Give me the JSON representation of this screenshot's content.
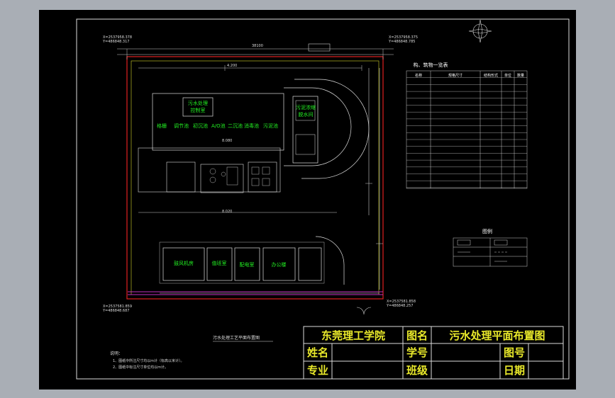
{
  "title_block": {
    "school": "东莞理工学院",
    "drawing_name_label": "图名",
    "drawing_name": "污水处理平面布置图",
    "name_label": "姓名",
    "student_id_label": "学号",
    "drawing_no_label": "图号",
    "major_label": "专业",
    "class_label": "班级",
    "date_label": "日期"
  },
  "plan": {
    "caption": "污水处理工艺平面布置图",
    "notes_title": "说明：",
    "note_1": "1、图纸中所注尺寸均以m计（标高以米计）。",
    "note_2": "2、图纸中标注尺寸单位均以m计。"
  },
  "buildings": {
    "top_green_1": "污水处理",
    "top_green_2": "控制室",
    "tanks_row": [
      "格栅",
      "调节池",
      "初沉池",
      "A/O池",
      "二沉池",
      "消毒池",
      "污泥池"
    ],
    "right_green_1": "污泥浓缩",
    "right_green_2": "脱水间",
    "bottom_rooms": [
      "鼓风机房",
      "值班室",
      "配电室",
      "办公楼"
    ]
  },
  "structures_table": {
    "title": "构、筑物一览表",
    "header": [
      "名称",
      "规格尺寸",
      "结构形式",
      "单位",
      "数量"
    ]
  },
  "legend": {
    "title": "图例"
  }
}
